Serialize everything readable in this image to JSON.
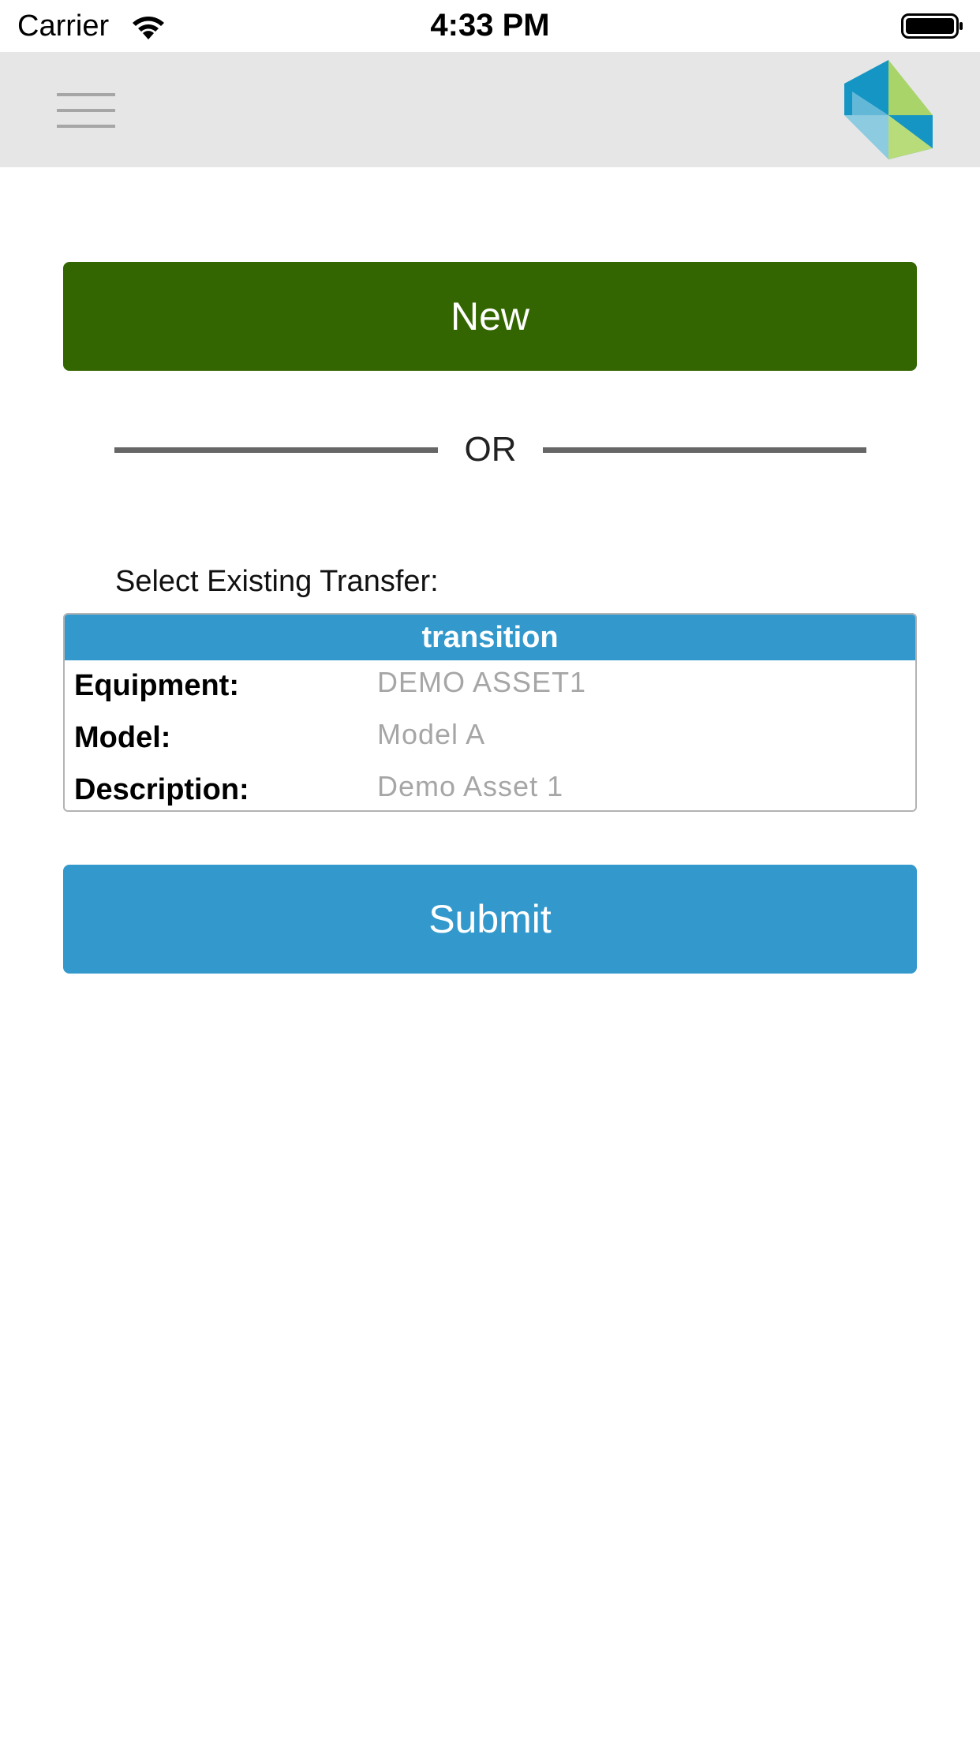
{
  "status_bar": {
    "carrier": "Carrier",
    "time": "4:33 PM"
  },
  "header": {
    "menu_icon": "hamburger-menu-icon",
    "logo_icon": "brand-logo-icon"
  },
  "actions": {
    "new_label": "New",
    "or_label": "OR",
    "submit_label": "Submit"
  },
  "select_label": "Select Existing Transfer:",
  "transfer": {
    "title": "transition",
    "rows": [
      {
        "label": "Equipment:",
        "value": "DEMO ASSET1"
      },
      {
        "label": "Model:",
        "value": "Model A"
      },
      {
        "label": "Description:",
        "value": "Demo Asset 1"
      }
    ]
  },
  "colors": {
    "new_button": "#336600",
    "submit_button": "#3399cc",
    "card_header": "#3399cc",
    "header_bar": "#e6e6e6"
  }
}
